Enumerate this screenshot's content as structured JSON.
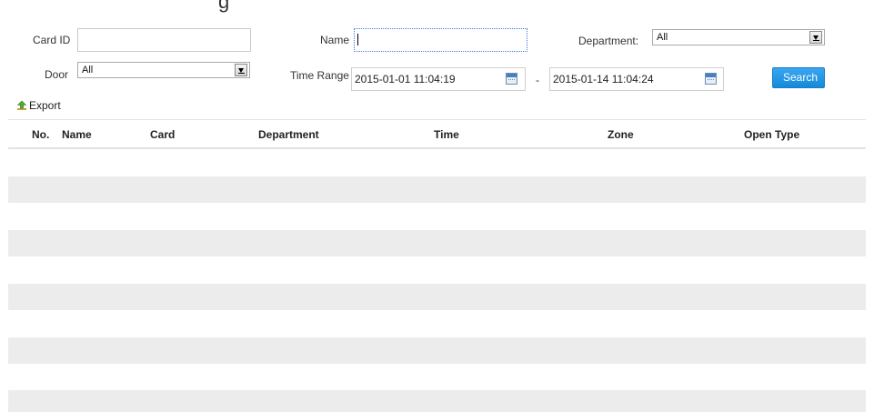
{
  "page_header_clip": "g",
  "filters": {
    "card_id": {
      "label": "Card ID",
      "value": ""
    },
    "name": {
      "label": "Name",
      "value": ""
    },
    "department": {
      "label": "Department:",
      "value": "All"
    },
    "door": {
      "label": "Door",
      "value": "All"
    },
    "time_range": {
      "label": "Time Range",
      "start": "2015-01-01 11:04:19",
      "separator": "-",
      "end": "2015-01-14 11:04:24"
    },
    "search_label": "Search"
  },
  "toolbar": {
    "export_label": "Export"
  },
  "table": {
    "columns": [
      "No.",
      "Name",
      "Card",
      "Department",
      "Time",
      "Zone",
      "Open Type"
    ],
    "rows": []
  },
  "colors": {
    "accent": "#1a8ad8",
    "row_alt": "#ececec",
    "border": "#e3e3e3"
  },
  "icons": {
    "date_picker": "calendar-icon",
    "export": "export-arrow-icon"
  }
}
